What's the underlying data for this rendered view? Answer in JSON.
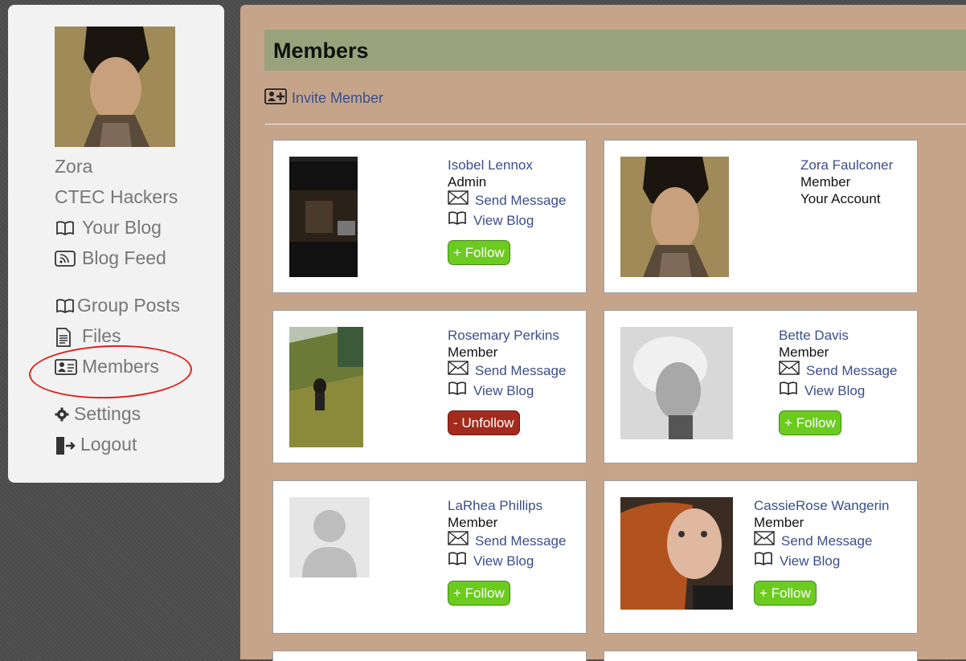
{
  "sidebar": {
    "avatar_alt": "Zora profile photo",
    "user_name": "Zora",
    "group_name": "CTEC Hackers",
    "items": [
      {
        "label": "Your Blog",
        "icon": "book-icon"
      },
      {
        "label": "Blog Feed",
        "icon": "rss-icon"
      },
      {
        "label": "Group Posts",
        "icon": "book-icon"
      },
      {
        "label": "Files",
        "icon": "document-icon"
      },
      {
        "label": "Members",
        "icon": "member-card-icon"
      },
      {
        "label": "Settings",
        "icon": "gear-icon"
      },
      {
        "label": "Logout",
        "icon": "logout-icon"
      }
    ]
  },
  "main": {
    "title": "Members",
    "invite_label": "Invite Member",
    "members": [
      {
        "name": "Isobel Lennox",
        "role": "Admin",
        "send": "Send Message",
        "blog": "View Blog",
        "button": "+ Follow"
      },
      {
        "name": "Zora Faulconer",
        "role": "Member",
        "note": "Your Account"
      },
      {
        "name": "Rosemary Perkins",
        "role": "Member",
        "send": "Send Message",
        "blog": "View Blog",
        "button": "- Unfollow"
      },
      {
        "name": "Bette Davis",
        "role": "Member",
        "send": "Send Message",
        "blog": "View Blog",
        "button": "+ Follow"
      },
      {
        "name": "LaRhea Phillips",
        "role": "Member",
        "send": "Send Message",
        "blog": "View Blog",
        "button": "+ Follow"
      },
      {
        "name": "CassieRose Wangerin",
        "role": "Member",
        "send": "Send Message",
        "blog": "View Blog",
        "button": "+ Follow"
      }
    ]
  },
  "colors": {
    "link": "#3b4e8c",
    "follow": "#6ccb1f",
    "unfollow": "#a32b1e",
    "header_bar": "#9aa27c",
    "panel": "#c6a48a"
  }
}
